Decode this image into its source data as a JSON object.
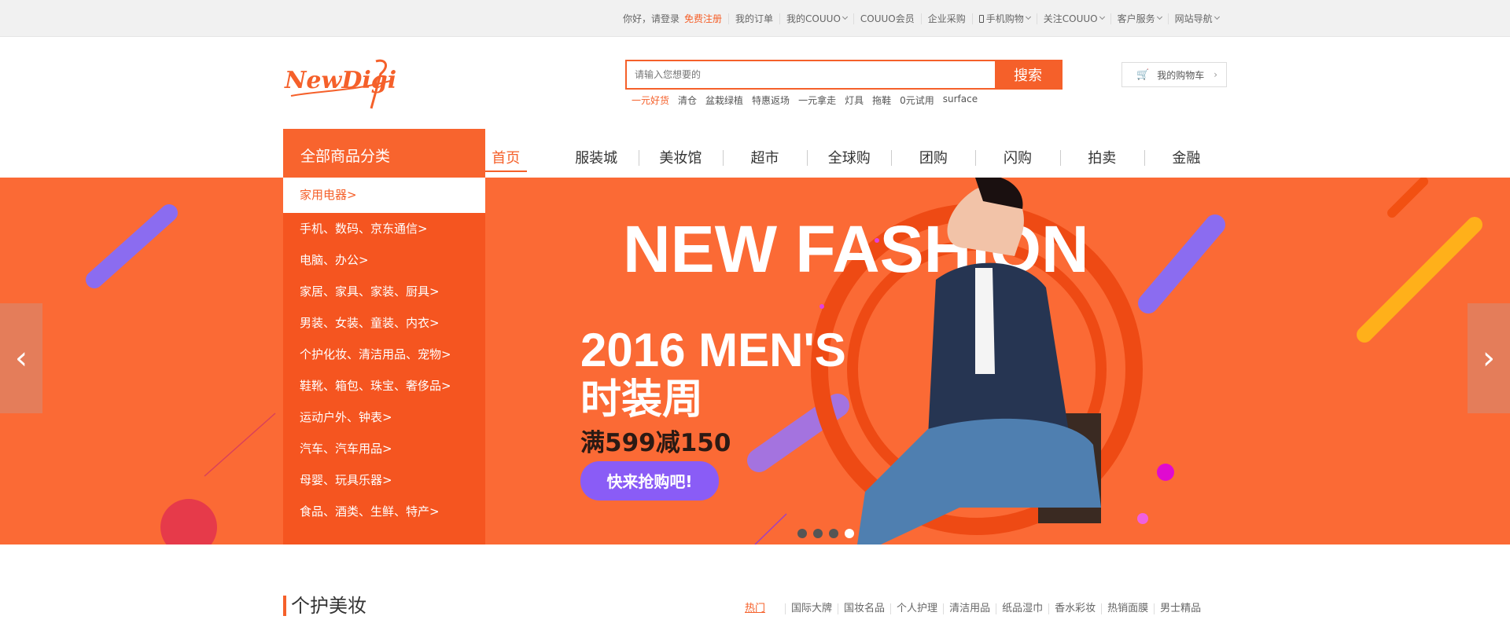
{
  "topbar": {
    "greeting": "你好，请登录",
    "register": "免费注册",
    "items": [
      "我的订单",
      "我的COUUO",
      "COUUO会员",
      "企业采购",
      "手机购物",
      "关注COUUO",
      "客户服务",
      "网站导航"
    ]
  },
  "logo": {
    "text": "NewDigi"
  },
  "search": {
    "placeholder": "请输入您想要的",
    "button": "搜索"
  },
  "hot_searches": [
    "一元好货",
    "清仓",
    "盆栽绿植",
    "特惠返场",
    "一元拿走",
    "灯具",
    "拖鞋",
    "0元试用",
    "surface"
  ],
  "cart": {
    "label": "我的购物车"
  },
  "category_header": "全部商品分类",
  "categories": [
    "家用电器>",
    "手机、数码、京东通信>",
    "电脑、办公>",
    "家居、家具、家装、厨具>",
    "男装、女装、童装、内衣>",
    "个护化妆、清洁用品、宠物>",
    "鞋靴、箱包、珠宝、奢侈品>",
    "运动户外、钟表>",
    "汽车、汽车用品>",
    "母婴、玩具乐器>",
    "食品、酒类、生鲜、特产>"
  ],
  "main_nav": [
    "首页",
    "服装城",
    "美妆馆",
    "超市",
    "全球购",
    "团购",
    "闪购",
    "拍卖",
    "金融"
  ],
  "banner": {
    "headline": "NEW FASHION",
    "sub": "2016 MEN'S",
    "cn_title": "时装周",
    "offer": "满599减150",
    "cta": "快来抢购吧!",
    "slides": 4,
    "active_slide": 4
  },
  "section": {
    "title": "个护美妆",
    "tabs": [
      "热门",
      "国际大牌",
      "国妆名品",
      "个人护理",
      "清洁用品",
      "纸品湿巾",
      "香水彩妆",
      "热销面膜",
      "男士精品"
    ]
  },
  "colors": {
    "accent": "#f5602a",
    "banner_bg": "#fb6a35",
    "cta": "#8a5cf6"
  }
}
